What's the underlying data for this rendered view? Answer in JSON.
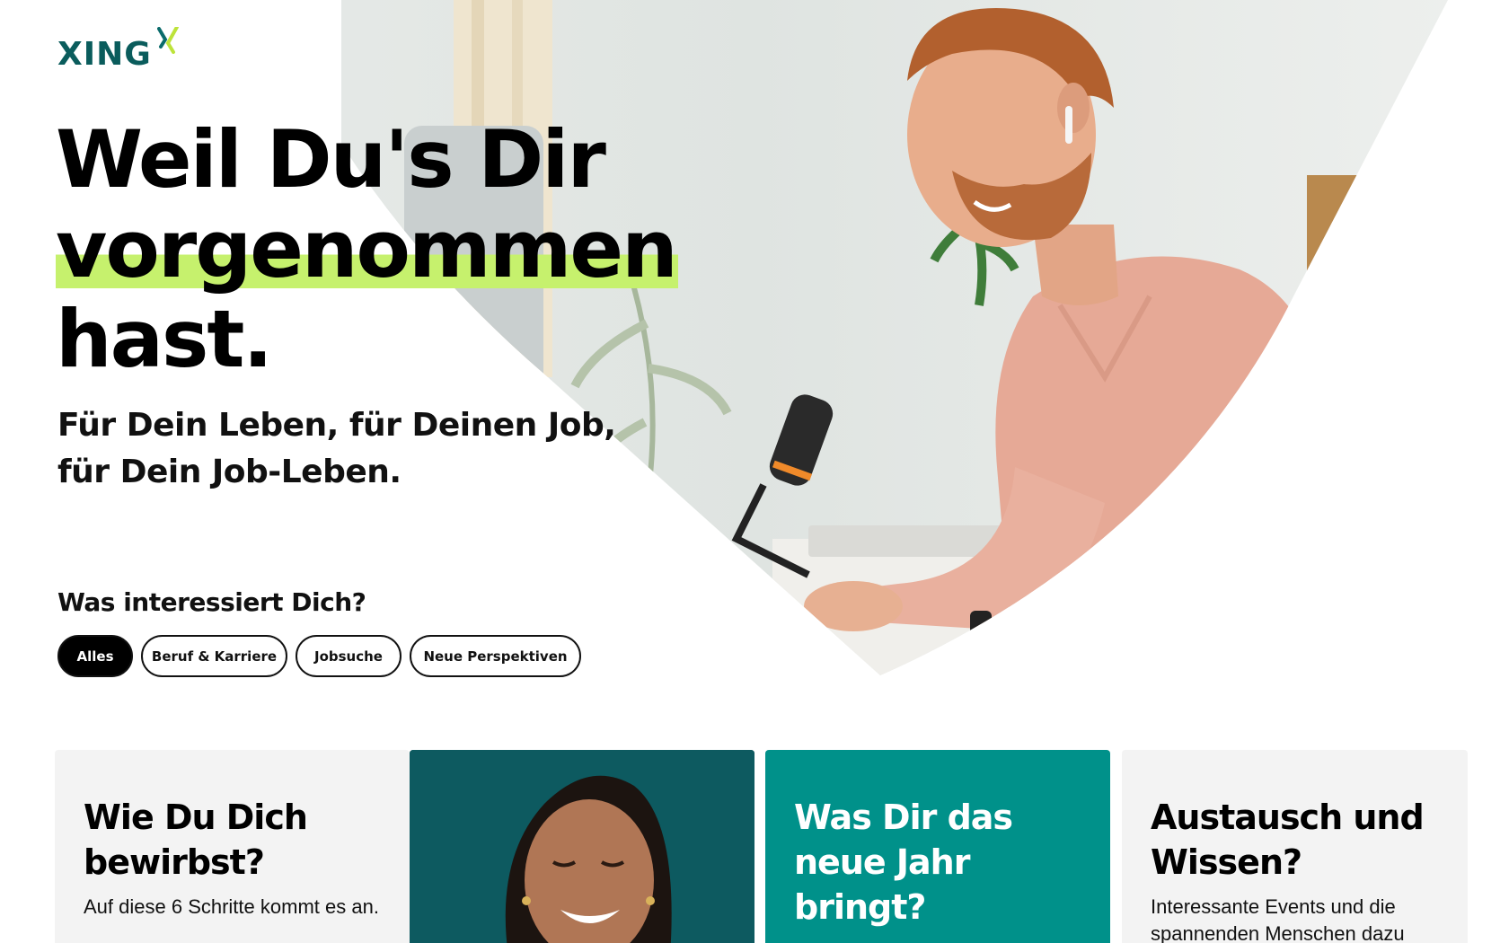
{
  "brand": {
    "logo_text": "XING",
    "logo_icon": "xing-x-icon",
    "accent": "#c6f16d",
    "primary": "#0a5c5c"
  },
  "hero": {
    "headline_line1": "Weil Du's Dir",
    "headline_line2": "vorgenommen",
    "headline_line3": "hast.",
    "subline_line1": "Für Dein Leben, für Deinen Job,",
    "subline_line2": "für Dein Job-Leben."
  },
  "interests": {
    "title": "Was interessiert Dich?",
    "chips": [
      {
        "label": "Alles",
        "active": true
      },
      {
        "label": "Beruf & Karriere",
        "active": false
      },
      {
        "label": "Jobsuche",
        "active": false
      },
      {
        "label": "Neue Perspektiven",
        "active": false
      }
    ]
  },
  "cards": [
    {
      "title": "Wie Du Dich bewirbst?",
      "text": "Auf diese 6 Schritte kommt es an.",
      "color": "#f3f3f3"
    },
    {
      "title": "",
      "text": "",
      "color": "#0d5a60"
    },
    {
      "title": "Was Dir das neue Jahr bringt?",
      "text": "",
      "color": "#00918a"
    },
    {
      "title": "Austausch und Wissen?",
      "text": "Interessante Events und die spannenden Menschen dazu",
      "color": "#f3f3f3"
    }
  ]
}
